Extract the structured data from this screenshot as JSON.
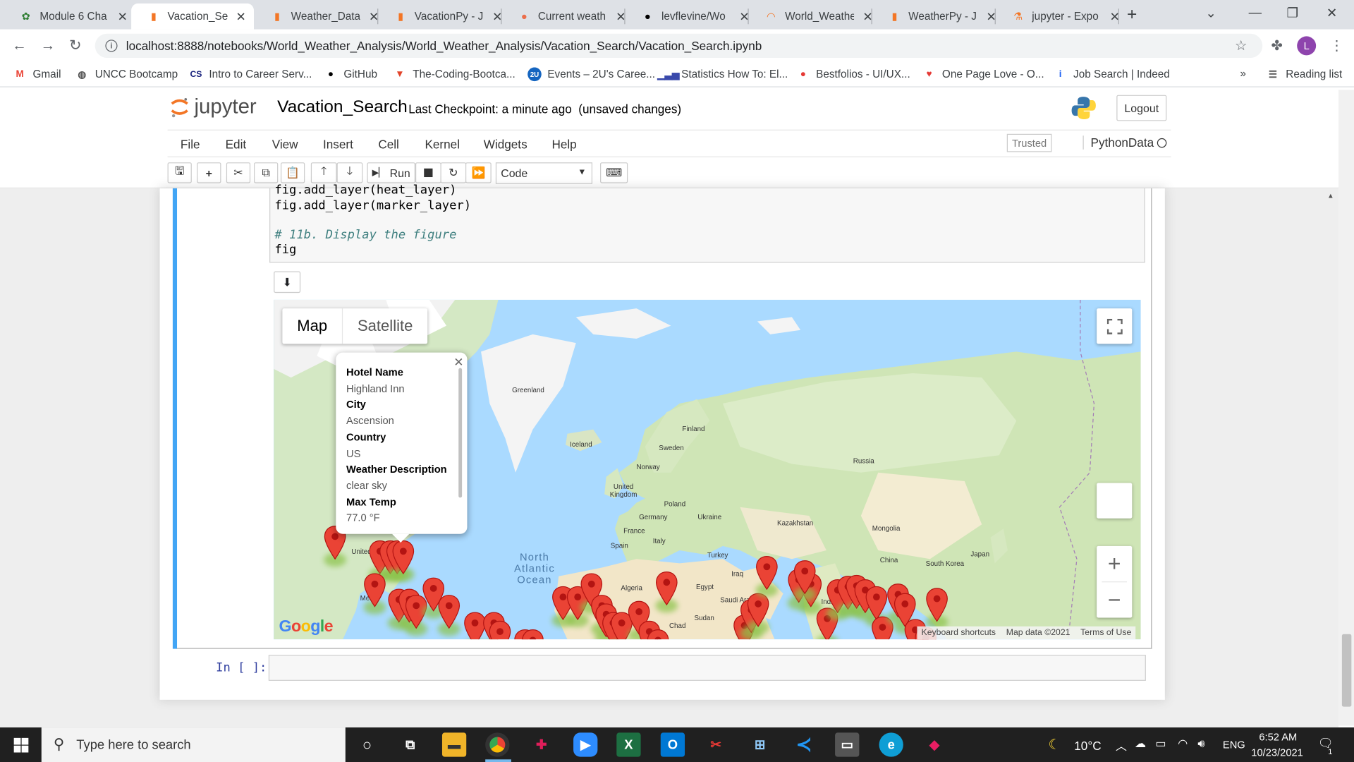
{
  "browser": {
    "tabs": [
      {
        "title": "Module 6 Cha",
        "favicon": "leaf-icon",
        "color": "#2e7d32"
      },
      {
        "title": "Vacation_Sear",
        "favicon": "notebook-icon",
        "color": "#f37626"
      },
      {
        "title": "Weather_Data",
        "favicon": "notebook-icon",
        "color": "#f37626"
      },
      {
        "title": "VacationPy - J",
        "favicon": "notebook-icon",
        "color": "#f37626"
      },
      {
        "title": "Current weath",
        "favicon": "cloud-icon",
        "color": "#eb6e4b"
      },
      {
        "title": "levflevine/Wo",
        "favicon": "github-icon",
        "color": "#000000"
      },
      {
        "title": "World_Weathe",
        "favicon": "loading-icon",
        "color": "#f37626"
      },
      {
        "title": "WeatherPy - J",
        "favicon": "notebook-icon",
        "color": "#f37626"
      },
      {
        "title": "jupyter - Expo",
        "favicon": "flask-icon",
        "color": "#f37626"
      }
    ],
    "url": "localhost:8888/notebooks/World_Weather_Analysis/World_Weather_Analysis/Vacation_Search/Vacation_Search.ipynb",
    "avatar_letter": "L",
    "bookmarks": [
      {
        "label": "Gmail",
        "icon": "gmail-icon"
      },
      {
        "label": "UNCC Bootcamp",
        "icon": "globe-icon"
      },
      {
        "label": "Intro to Career Serv...",
        "icon": "cs-icon"
      },
      {
        "label": "GitHub",
        "icon": "github-icon"
      },
      {
        "label": "The-Coding-Bootca...",
        "icon": "gitlab-icon"
      },
      {
        "label": "Events – 2U's Caree...",
        "icon": "2u-icon"
      },
      {
        "label": "Statistics How To: El...",
        "icon": "chart-icon"
      },
      {
        "label": "Bestfolios - UI/UX...",
        "icon": "bestfolios-icon"
      },
      {
        "label": "One Page Love - O...",
        "icon": "heart-icon"
      },
      {
        "label": "Job Search | Indeed",
        "icon": "indeed-icon"
      }
    ],
    "more_bookmarks": "»",
    "reading_list": "Reading list"
  },
  "jupyter": {
    "logo_text": "jupyter",
    "notebook_name": "Vacation_Search",
    "checkpoint": "Last Checkpoint: a minute ago",
    "unsaved": "(unsaved changes)",
    "logout": "Logout",
    "menus": [
      "File",
      "Edit",
      "View",
      "Insert",
      "Cell",
      "Kernel",
      "Widgets",
      "Help"
    ],
    "trusted": "Trusted",
    "kernel": "PythonData",
    "run_label": "Run",
    "cell_type": "Code"
  },
  "cell": {
    "lines": [
      {
        "text": "fig.add_layer(heat_layer)",
        "comment": false
      },
      {
        "text": "fig.add_layer(marker_layer)",
        "comment": false
      },
      {
        "text": "",
        "comment": false
      },
      {
        "text": "# 11b. Display the figure",
        "comment": true
      },
      {
        "text": "fig",
        "comment": false
      }
    ],
    "next_prompt": "In [ ]:"
  },
  "map": {
    "type_buttons": [
      "Map",
      "Satellite"
    ],
    "labels": {
      "greenland": "Greenland",
      "iceland": "Iceland",
      "finland": "Finland",
      "sweden": "Sweden",
      "norway": "Norway",
      "russia": "Russia",
      "uk": "United Kingdom",
      "poland": "Poland",
      "germany": "Germany",
      "ukraine": "Ukraine",
      "kazakhstan": "Kazakhstan",
      "mongolia": "Mongolia",
      "france": "France",
      "italy": "Italy",
      "spain": "Spain",
      "turkey": "Turkey",
      "china": "China",
      "south_korea": "South Korea",
      "japan": "Japan",
      "iraq": "Iraq",
      "algeria": "Algeria",
      "egypt": "Egypt",
      "saudi": "Saudi Arabia",
      "sudan": "Sudan",
      "chad": "Chad",
      "india": "India",
      "united": "United",
      "mexico": "Me...",
      "ocean": "North Atlantic Ocean"
    },
    "info_window": {
      "fields": [
        {
          "label": "Hotel Name",
          "value": "Highland Inn"
        },
        {
          "label": "City",
          "value": "Ascension"
        },
        {
          "label": "Country",
          "value": "US"
        },
        {
          "label": "Weather Description",
          "value": "clear sky"
        },
        {
          "label": "Max Temp",
          "value": "77.0 °F"
        }
      ]
    },
    "attribution": [
      "Keyboard shortcuts",
      "Map data ©2021",
      "Terms of Use"
    ],
    "google": "Google",
    "marker_color": "#ea4335",
    "heat_color": "#8bc34a"
  },
  "taskbar": {
    "search_placeholder": "Type here to search",
    "temperature": "10°C",
    "language": "ENG",
    "time": "6:52 AM",
    "date": "10/23/2021",
    "notifications": "1"
  }
}
